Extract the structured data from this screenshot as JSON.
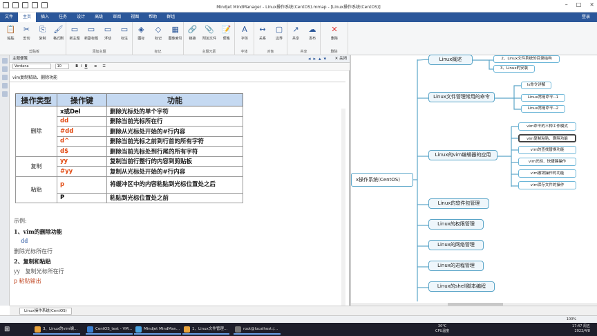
{
  "window": {
    "title": "Mindjet MindManager - Linux操作系统(CentOS).mmap - [Linux操作系统(CentOS)]",
    "login": "登录"
  },
  "menu": [
    "文件",
    "主页",
    "插入",
    "任务",
    "设计",
    "高级",
    "审阅",
    "视图",
    "帮助",
    "群组"
  ],
  "menu_active": "主页",
  "ribbon": {
    "groups": [
      {
        "label": "剪贴板",
        "buttons": [
          "粘贴",
          "剪切",
          "复制",
          "格式刷"
        ]
      },
      {
        "label": "添加主题",
        "buttons": [
          "新主题",
          "新副标题",
          "浮动",
          "标注"
        ]
      },
      {
        "label": "标记",
        "buttons": [
          "图标",
          "标记",
          "图像索引"
        ]
      },
      {
        "label": "主题元素",
        "buttons": [
          "链接",
          "附加文件",
          "便笺"
        ]
      },
      {
        "label": "字体",
        "buttons": [
          "字体"
        ]
      },
      {
        "label": "对象",
        "buttons": [
          "关系",
          "边界"
        ]
      },
      {
        "label": "共享",
        "buttons": [
          "共享",
          "发布"
        ]
      },
      {
        "label": "删除",
        "buttons": [
          "删除"
        ]
      }
    ]
  },
  "notes": {
    "header": "主题便笺",
    "close_label": "关闭",
    "font_name": "Verdana",
    "font_size": "10",
    "topic_title": "vim复制粘贴、删除功能"
  },
  "table": {
    "headers": [
      "操作类型",
      "操作键",
      "功能"
    ],
    "groups": [
      {
        "type": "删除",
        "rows": [
          {
            "key": "x或Del",
            "key_color": "black",
            "desc": "删除光标处的单个字符"
          },
          {
            "key": "dd",
            "key_color": "red",
            "desc": "删除当前光标所在行"
          },
          {
            "key": "#dd",
            "key_color": "red",
            "desc": "删除从光标处开始的#行内容"
          },
          {
            "key": "d^",
            "key_color": "red",
            "desc": "删除当前光标之前到行首的所有字符"
          },
          {
            "key": "d$",
            "key_color": "red",
            "desc": "删除当前光标处到行尾的所有字符"
          }
        ]
      },
      {
        "type": "复制",
        "rows": [
          {
            "key": "yy",
            "key_color": "red",
            "desc": "复制当前行整行的内容到剪贴板"
          },
          {
            "key": "#yy",
            "key_color": "red",
            "desc": "复制从光标处开始的#行内容"
          }
        ]
      },
      {
        "type": "粘贴",
        "rows": [
          {
            "key": "p",
            "key_color": "red",
            "desc": "将缓冲区中的内容粘贴到光标位置处之后"
          },
          {
            "key": "P",
            "key_color": "black",
            "desc": "粘贴到光标位置处之前"
          }
        ]
      }
    ]
  },
  "examples": [
    {
      "text": "示例:",
      "style": "ex-gray"
    },
    {
      "text": "1、vim的删除功能",
      "style": "ex-b"
    },
    {
      "text": "    dd",
      "style": "ex-blue"
    },
    {
      "text": "删除光标所在行",
      "style": "ex-gray"
    },
    {
      "text": "2、复制和粘贴",
      "style": "ex-b"
    },
    {
      "text": "yy   复制光标所在行",
      "style": "ex-gray"
    },
    {
      "text": "p 粘贴输出",
      "style": "ex-red"
    }
  ],
  "doc_tab": "Linux操作系统(CentOS)",
  "status": {
    "zoom": "100%"
  },
  "mindmap": {
    "center": "x操作系统(CentOS)",
    "topics": [
      {
        "label": "Linux概述"
      },
      {
        "label": "Linux文件管理常用的命令"
      },
      {
        "label": "Linux的vim编辑器的应用"
      },
      {
        "label": "Linux的软件包管理"
      },
      {
        "label": "Linux的权限管理"
      },
      {
        "label": "Linux的网络管理"
      },
      {
        "label": "Linux的进程管理"
      },
      {
        "label": "Linux的shell脚本编程"
      }
    ],
    "subtopics": {
      "overview": [
        "2、Linux文件系统的目录结构",
        "3、Linux的安装"
      ],
      "files": [
        "ls命令详解",
        "Linux常用命令--1",
        "Linux常用命令--2"
      ],
      "vim": [
        "vim命令的三种工作模式",
        "vim复制粘贴、删除功能",
        "vim的查找替换功能",
        "vim光标、快捷键操作",
        "vim撤销操作的功能",
        "vim保存文件的操作"
      ]
    }
  },
  "taskbar": {
    "items": [
      "3、Linux的vim编...",
      "CentOS_test - VM...",
      "Mindjet MindMan...",
      "1、Linux文件管理...",
      "root@localhost:/..."
    ],
    "weather_temp": "30°C",
    "weather_label": "CPU温度",
    "time": "17:47 周五",
    "date": "2022/4/8"
  },
  "colors": {
    "accent": "#2b579a",
    "header_fill": "#c5d9f1",
    "key_red": "#e24a12",
    "map_line": "#5aa5c8"
  }
}
